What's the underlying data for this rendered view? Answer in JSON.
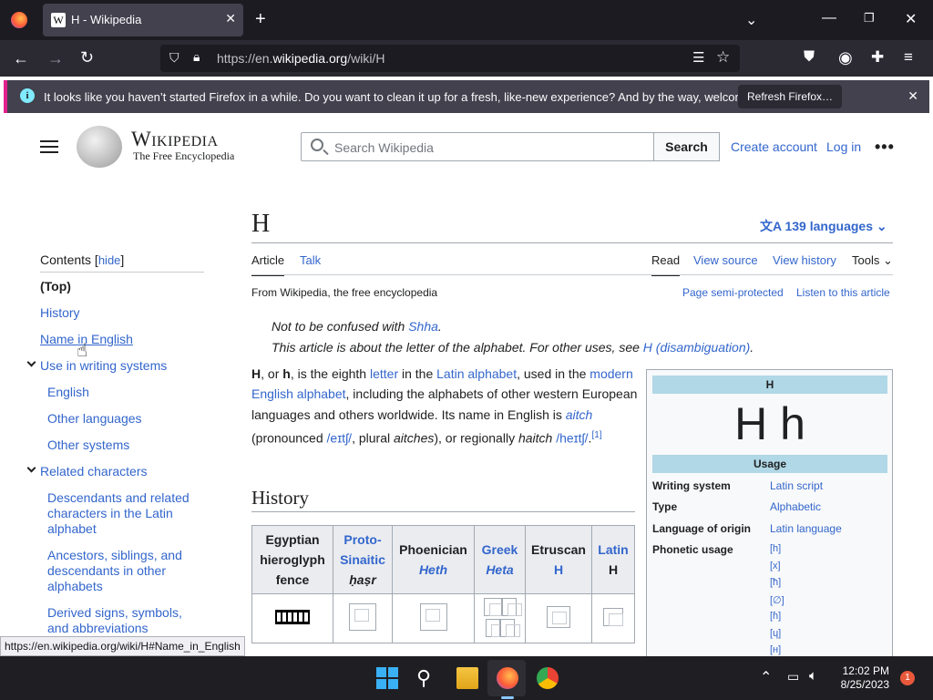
{
  "browser": {
    "tab_title": "H - Wikipedia",
    "tab_favicon": "W",
    "url_prefix": "https://en.",
    "url_host": "wikipedia.org",
    "url_path": "/wiki/H",
    "notification": "It looks like you haven’t started Firefox in a while. Do you want to clean it up for a fresh, like-new experience? And by the way, welcome back!",
    "notification_button": "Refresh Firefox…",
    "status_url": "https://en.wikipedia.org/wiki/H#Name_in_English"
  },
  "wiki": {
    "logo_title": "Wikipedia",
    "logo_subtitle": "The Free Encyclopedia",
    "search_placeholder": "Search Wikipedia",
    "search_button": "Search",
    "create_account": "Create account",
    "log_in": "Log in",
    "more": "•••"
  },
  "toc": {
    "heading": "Contents",
    "hide_label": "hide",
    "items": [
      "(Top)",
      "History",
      "Name in English",
      "Use in writing systems",
      "English",
      "Other languages",
      "Other systems",
      "Related characters",
      "Descendants and related characters in the Latin alphabet",
      "Ancestors, siblings, and descendants in other alphabets",
      "Derived signs, symbols, and abbreviations"
    ]
  },
  "article": {
    "title": "H",
    "languages": "139 languages",
    "tabs": {
      "article": "Article",
      "talk": "Talk",
      "read": "Read",
      "view_source": "View source",
      "view_history": "View history",
      "tools": "Tools"
    },
    "from": "From Wikipedia, the free encyclopedia",
    "semi_protected": "Page semi-protected",
    "listen": "Listen to this article",
    "hatnote1_pre": "Not to be confused with ",
    "hatnote1_link": "Shha",
    "hatnote2_pre": "This article is about the letter of the alphabet. For other uses, see ",
    "hatnote2_link": "H (disambiguation)",
    "intro": {
      "t1": "H",
      "t2": ", or ",
      "t3": "h",
      "t4": ", is the eighth ",
      "link_letter": "letter",
      "t5": " in the ",
      "link_latin": "Latin alphabet",
      "t6": ", used in the ",
      "link_modern": "modern English alphabet",
      "t7": ", including the alphabets of other western European languages and others worldwide. Its name in English is ",
      "aitch": "aitch",
      "t8": " (pronounced ",
      "ipa1": "/eɪtʃ/",
      "t9": ", plural ",
      "aitches": "aitches",
      "t10": "), or regionally ",
      "haitch": "haitch",
      "t11": " ",
      "ipa2": "/heɪtʃ/",
      "t12": ".",
      "ref": "[1]"
    },
    "history_heading": "History",
    "history_table": {
      "headers": [
        {
          "line1": "Egyptian",
          "line2": "hieroglyph",
          "line3": "fence"
        },
        {
          "line1": "Proto-",
          "line2": "Sinaitic",
          "line3": "ḥaṣr"
        },
        {
          "line1": "Phoenician",
          "line2": "Heth",
          "line3": ""
        },
        {
          "line1": "Greek",
          "line2": "Heta",
          "line3": ""
        },
        {
          "line1": "Etruscan",
          "line2": "H",
          "line3": ""
        },
        {
          "line1": "Latin",
          "line2": "H",
          "line3": ""
        }
      ]
    }
  },
  "infobox": {
    "title": "H",
    "glyph": "H h",
    "usage": "Usage",
    "rows": [
      {
        "label": "Writing system",
        "value": "Latin script"
      },
      {
        "label": "Type",
        "value": "Alphabetic"
      },
      {
        "label": "Language of origin",
        "value": "Latin language"
      },
      {
        "label": "Phonetic usage",
        "value": "[h]"
      }
    ],
    "phonetic_more": [
      "[x]",
      "[ħ]",
      "[∅]",
      "[ɦ]",
      "[ɥ]",
      "[ʜ]"
    ]
  },
  "taskbar": {
    "time": "12:02 PM",
    "date": "8/25/2023",
    "notifications": "1"
  },
  "colors": {
    "link": "#3366cc",
    "infobox_header": "#b0d8e6",
    "notification_accent": "#e0228e"
  }
}
